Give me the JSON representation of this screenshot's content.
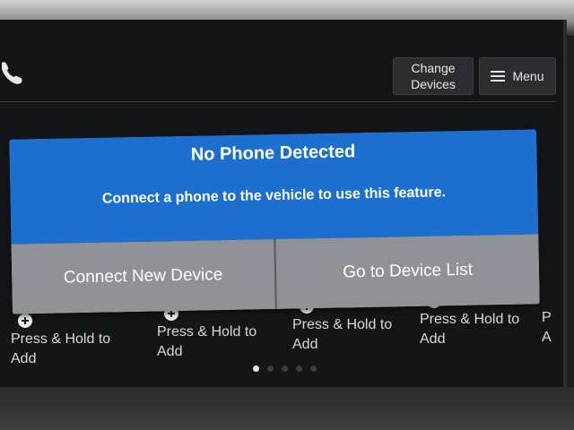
{
  "header": {
    "phone_icon": "phone-icon",
    "change_devices_label": "Change\nDevices",
    "menu_label": "Menu",
    "menu_icon": "hamburger-icon"
  },
  "dialog": {
    "title": "No Phone Detected",
    "message": "Connect a phone to the vehicle to use this feature.",
    "connect_button": "Connect New Device",
    "device_list_button": "Go to Device List",
    "background_color": "#1d6fcf"
  },
  "speed_dial": [
    {
      "label": "Press & Hold to\nAdd"
    },
    {
      "label": "Press & Hold to\nAdd"
    },
    {
      "label": "Press & Hold to\nAdd"
    },
    {
      "label": "Press & Hold to\nAdd"
    },
    {
      "label": "P\nA"
    }
  ],
  "pager": {
    "total_pages": 5,
    "active_page": 1
  }
}
